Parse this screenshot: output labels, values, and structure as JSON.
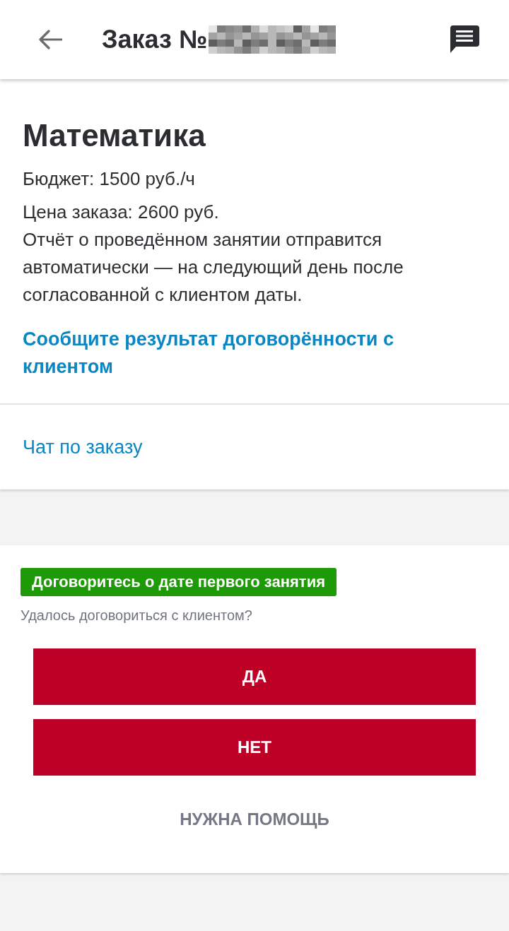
{
  "header": {
    "title": "Заказ №"
  },
  "order": {
    "subject": "Математика",
    "budget": "Бюджет: 1500 руб./ч",
    "price": "Цена заказа: 2600 руб.",
    "note": "Отчёт о проведённом занятии отправится автоматически — на следующий день после согласованной с клиентом даты.",
    "report_link": "Сообщите результат договорённости с клиентом",
    "chat_link": "Чат по заказу"
  },
  "agreement": {
    "badge": "Договоритесь о дате первого занятия",
    "question": "Удалось договориться с клиентом?",
    "buttons": [
      {
        "label": "ДА",
        "kind": "primary"
      },
      {
        "label": "НЕТ",
        "kind": "primary"
      },
      {
        "label": "НУЖНА ПОМОЩЬ",
        "kind": "text"
      }
    ]
  }
}
